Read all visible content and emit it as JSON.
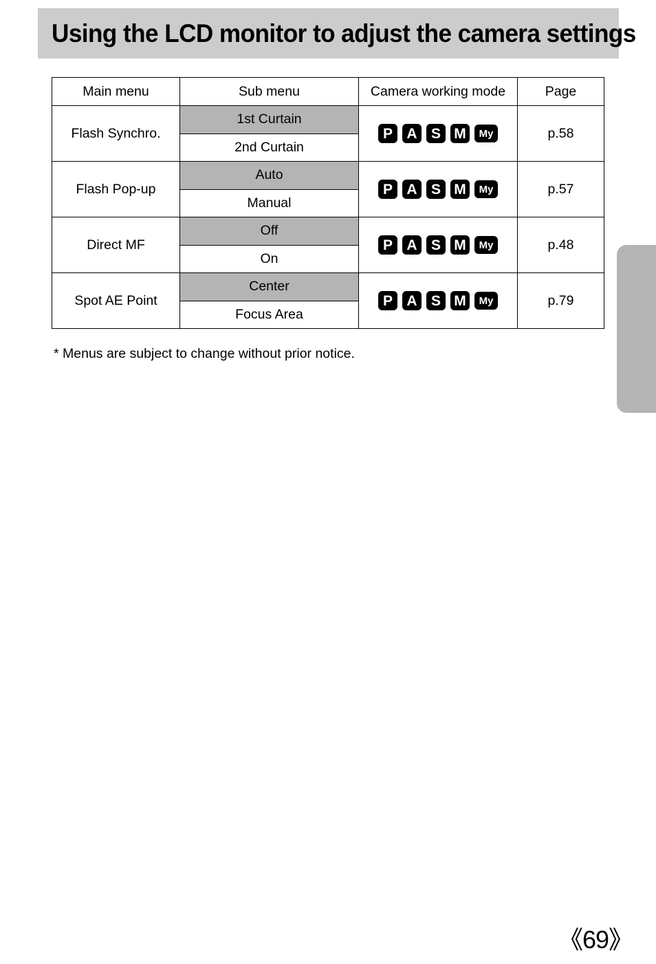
{
  "header": {
    "title": "Using the LCD monitor to adjust the camera settings",
    "banner_color": "#cccccc"
  },
  "table": {
    "columns": [
      {
        "key": "main_menu",
        "label": "Main menu"
      },
      {
        "key": "sub_menu",
        "label": "Sub menu"
      },
      {
        "key": "camera_mode",
        "label": "Camera working mode"
      },
      {
        "key": "page",
        "label": "Page"
      }
    ],
    "shaded_color": "#b4b4b4",
    "rows": [
      {
        "main_menu": "Flash Synchro.",
        "sub_menu": [
          "1st Curtain",
          "2nd Curtain"
        ],
        "modes": [
          "P",
          "A",
          "S",
          "M",
          "My"
        ],
        "page": "p.58"
      },
      {
        "main_menu": "Flash Pop-up",
        "sub_menu": [
          "Auto",
          "Manual"
        ],
        "modes": [
          "P",
          "A",
          "S",
          "M",
          "My"
        ],
        "page": "p.57"
      },
      {
        "main_menu": "Direct MF",
        "sub_menu": [
          "Off",
          "On"
        ],
        "modes": [
          "P",
          "A",
          "S",
          "M",
          "My"
        ],
        "page": "p.48"
      },
      {
        "main_menu": "Spot AE Point",
        "sub_menu": [
          "Center",
          "Focus Area"
        ],
        "modes": [
          "P",
          "A",
          "S",
          "M",
          "My"
        ],
        "page": "p.79"
      }
    ]
  },
  "footnote": "* Menus are subject to change without prior notice.",
  "page_number": "《69》",
  "side_tab": {
    "color": "#b4b4b4",
    "label": ""
  }
}
